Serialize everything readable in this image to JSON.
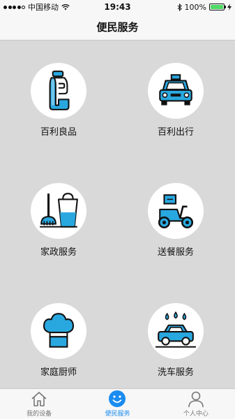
{
  "status_bar": {
    "carrier": "中国移动",
    "time": "19:43",
    "battery_percent": "100%",
    "battery_level": 1.0,
    "icons": [
      "signal-dots-icon",
      "wifi-icon",
      "bluetooth-icon",
      "battery-icon",
      "charging-icon"
    ]
  },
  "nav": {
    "title": "便民服务"
  },
  "services": [
    {
      "label": "百利良品",
      "icon": "bottle-icon"
    },
    {
      "label": "百利出行",
      "icon": "taxi-icon"
    },
    {
      "label": "家政服务",
      "icon": "broom-bucket-icon"
    },
    {
      "label": "送餐服务",
      "icon": "delivery-scooter-icon"
    },
    {
      "label": "家庭厨师",
      "icon": "chef-hat-icon"
    },
    {
      "label": "洗车服务",
      "icon": "car-wash-icon"
    }
  ],
  "tabs": [
    {
      "label": "我的设备",
      "icon": "home-icon",
      "active": false
    },
    {
      "label": "便民服务",
      "icon": "smiley-icon",
      "active": true
    },
    {
      "label": "个人中心",
      "icon": "person-icon",
      "active": false
    }
  ],
  "colors": {
    "accent": "#1a8cf0",
    "icon_fill": "#29a8e0",
    "background": "#d9d9d9"
  }
}
